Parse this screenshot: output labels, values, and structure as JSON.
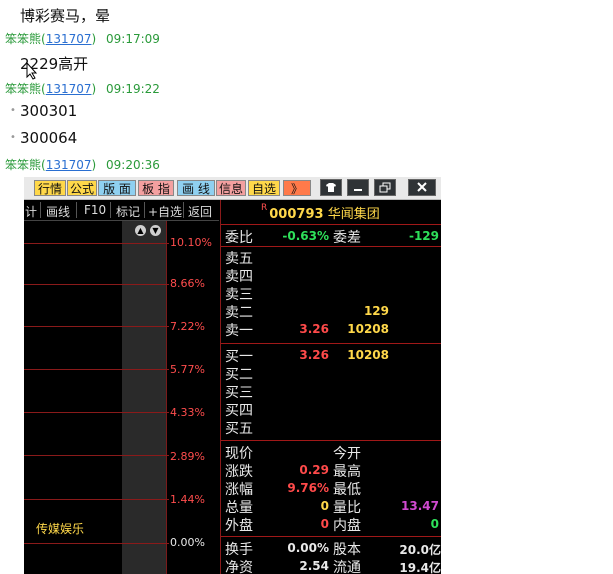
{
  "chat": {
    "messages": [
      {
        "text": "博彩赛马，晕"
      },
      {
        "user": "笨笨熊",
        "uid": "131707",
        "time": "09:17:09"
      },
      {
        "text": "2229高开"
      },
      {
        "user": "笨笨熊",
        "uid": "131707",
        "time": "09:19:22"
      },
      {
        "text": "300301"
      },
      {
        "text": "300064"
      },
      {
        "user": "笨笨熊",
        "uid": "131707",
        "time": "09:20:36"
      }
    ]
  },
  "window": {
    "tabs": [
      "行情",
      "公式",
      "版 面",
      "板 指",
      "画 线",
      "信息",
      "自选",
      "》"
    ],
    "controls": [
      "shirt-icon",
      "minimize-icon",
      "restore-icon",
      "close-icon"
    ]
  },
  "toolbar": {
    "items": [
      "计",
      "画线",
      "F10",
      "标记",
      "+自选",
      "返回"
    ]
  },
  "chart": {
    "percent_labels": [
      "10.10%",
      "8.66%",
      "7.22%",
      "5.77%",
      "4.33%",
      "2.89%",
      "1.44%",
      "0.00%"
    ],
    "sector_label": "传媒娱乐"
  },
  "quote": {
    "flag": "R",
    "code": "000793",
    "name": "华闻集团",
    "weibi_label": "委比",
    "weibi_value": "-0.63%",
    "weicha_label": "委差",
    "weicha_value": "-129",
    "sell": [
      {
        "label": "卖五",
        "price": "",
        "vol": ""
      },
      {
        "label": "卖四",
        "price": "",
        "vol": ""
      },
      {
        "label": "卖三",
        "price": "",
        "vol": ""
      },
      {
        "label": "卖二",
        "price": "",
        "vol": "129"
      },
      {
        "label": "卖一",
        "price": "3.26",
        "vol": "10208"
      }
    ],
    "buy": [
      {
        "label": "买一",
        "price": "3.26",
        "vol": "10208"
      },
      {
        "label": "买二",
        "price": "",
        "vol": ""
      },
      {
        "label": "买三",
        "price": "",
        "vol": ""
      },
      {
        "label": "买四",
        "price": "",
        "vol": ""
      },
      {
        "label": "买五",
        "price": "",
        "vol": ""
      }
    ],
    "stats": [
      {
        "l1": "现价",
        "v1": "",
        "l2": "今开",
        "v2": ""
      },
      {
        "l1": "涨跌",
        "v1": "0.29",
        "l2": "最高",
        "v2": ""
      },
      {
        "l1": "涨幅",
        "v1": "9.76%",
        "l2": "最低",
        "v2": ""
      },
      {
        "l1": "总量",
        "v1": "0",
        "l2": "量比",
        "v2": "13.47"
      },
      {
        "l1": "外盘",
        "v1": "0",
        "l2": "内盘",
        "v2": "0"
      },
      {
        "l1": "换手",
        "v1": "0.00%",
        "l2": "股本",
        "v2": "20.0亿"
      },
      {
        "l1": "净资",
        "v1": "2.54",
        "l2": "流通",
        "v2": "19.4亿"
      }
    ]
  }
}
